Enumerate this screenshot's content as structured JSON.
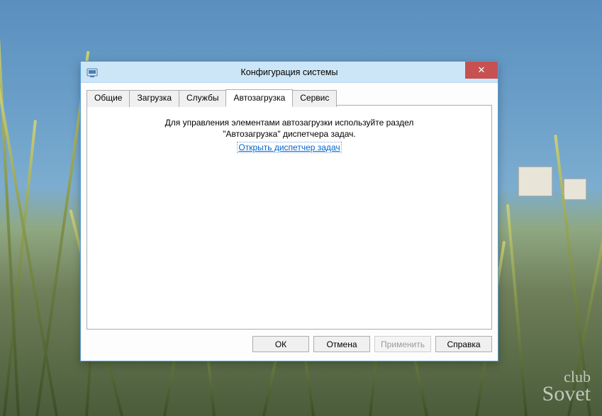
{
  "watermark": {
    "line1": "club",
    "line2": "Sovet"
  },
  "window": {
    "title": "Конфигурация системы",
    "close_label": "✕",
    "tabs": [
      {
        "label": "Общие",
        "active": false
      },
      {
        "label": "Загрузка",
        "active": false
      },
      {
        "label": "Службы",
        "active": false
      },
      {
        "label": "Автозагрузка",
        "active": true
      },
      {
        "label": "Сервис",
        "active": false
      }
    ],
    "panel": {
      "message_line1": "Для управления элементами автозагрузки используйте раздел",
      "message_line2": "\"Автозагрузка\" диспетчера задач.",
      "link_label": "Открыть диспетчер задач"
    },
    "buttons": {
      "ok": "ОК",
      "cancel": "Отмена",
      "apply": "Применить",
      "help": "Справка",
      "apply_enabled": false
    }
  }
}
